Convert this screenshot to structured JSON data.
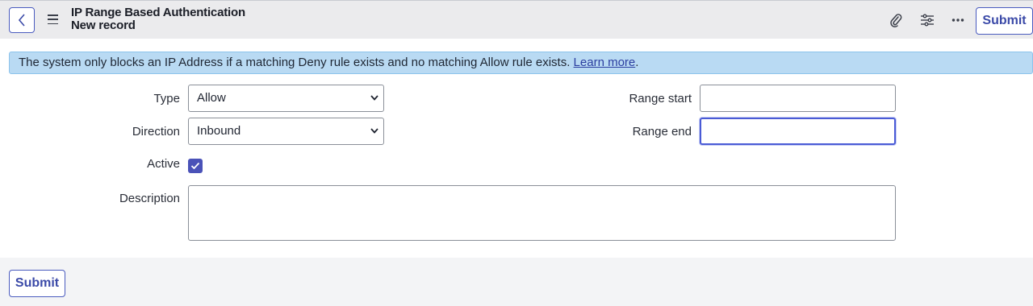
{
  "header": {
    "title": "IP Range Based Authentication",
    "subtitle": "New record",
    "submit_label": "Submit",
    "icons": [
      "chevron-left-icon",
      "hamburger-menu-icon",
      "paperclip-icon",
      "sliders-icon",
      "more-icon"
    ]
  },
  "banner": {
    "text": "The system only blocks an IP Address if a matching Deny rule exists and no matching Allow rule exists. ",
    "link": "Learn more",
    "suffix": "."
  },
  "form": {
    "type_label": "Type",
    "type_value": "Allow",
    "direction_label": "Direction",
    "direction_value": "Inbound",
    "active_label": "Active",
    "active_checked": true,
    "description_label": "Description",
    "description_value": "",
    "range_start_label": "Range start",
    "range_start_value": "",
    "range_end_label": "Range end",
    "range_end_value": ""
  },
  "footer": {
    "submit_label": "Submit"
  },
  "colors": {
    "accent": "#4a5bbf",
    "banner_bg": "#b9daf3",
    "checkbox": "#4a52b8"
  }
}
